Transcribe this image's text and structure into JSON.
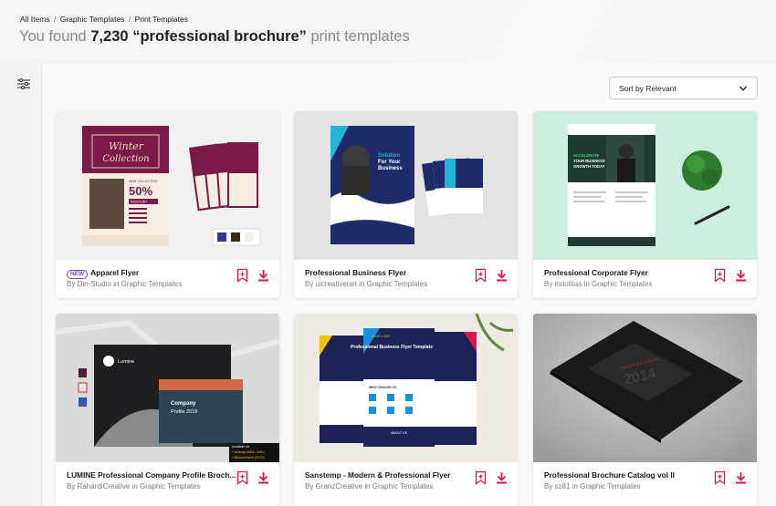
{
  "breadcrumb": {
    "items": [
      "All Items",
      "Graphic Templates",
      "Print Templates"
    ],
    "separator": "/"
  },
  "headline": {
    "prefix": "You found",
    "count": "7,230",
    "query": "“professional brochure”",
    "suffix": "print templates"
  },
  "filters": {
    "icon": "sliders-icon"
  },
  "sort": {
    "label": "Sort by Relevant",
    "icon": "chevron-down-icon"
  },
  "colors": {
    "accent": "#e4144a",
    "new_badge": "#7b3fd4"
  },
  "results": [
    {
      "title": "Apparel Flyer",
      "author": "By Din-Studio in Graphic Templates",
      "new": "NEW",
      "thumb_bg": "#f1f1f1"
    },
    {
      "title": "Professional Business Flyer",
      "author": "By uicreativenet in Graphic Templates",
      "new": "",
      "thumb_bg": "#e6e6e6"
    },
    {
      "title": "Professional Corporate Flyer",
      "author": "By indotitas in Graphic Templates",
      "new": "",
      "thumb_bg": "#cdeedd"
    },
    {
      "title": "LUMINE Professional Company Profile Broch...",
      "author": "By RahardiCreative in Graphic Templates",
      "new": "",
      "thumb_bg": "#d8d8d8",
      "thumb_text": {
        "brand": "Lumine",
        "cover_title": "Company",
        "cover_sub": "Profile 2019",
        "available": "Available on",
        "format1": "» InDesign (INDD, IDML)",
        "format2": "» Microsoft Word (DOCX)"
      }
    },
    {
      "title": "Sanstemp - Modern & Professional Flyer",
      "author": "By GranzCreative in Graphic Templates",
      "new": "",
      "thumb_bg": "#efeae4",
      "thumb_text": {
        "logo": "YOUR LOGO",
        "headline": "Professional Business Flyer Template",
        "section": "WHO CHOOSE US",
        "about": "ABOUT US"
      }
    },
    {
      "title": "Professional Brochure Catalog vol II",
      "author": "By sz81 in Graphic Templates",
      "new": "",
      "thumb_bg": "#bdbdbd",
      "thumb_text": {
        "year": "2014",
        "cover_label": "BROCHURE CATALOG"
      }
    }
  ],
  "card_actions": {
    "bookmark_icon": "bookmark-add-icon",
    "download_icon": "download-icon"
  },
  "thumb_text_1": {
    "winter": "Winter",
    "collection": "Collection",
    "new_collection": "NEW COLLECTION",
    "discount": "50%",
    "off": "DISCOUNT"
  },
  "thumb_text_2": {
    "headline_a": "Solution",
    "headline_b": "For Your",
    "headline_c": "Business"
  },
  "thumb_text_3": {
    "headline_a": "ACCELERATE",
    "headline_b": "YOUR BUSINESS",
    "headline_c": "GROWTH TODAY"
  }
}
